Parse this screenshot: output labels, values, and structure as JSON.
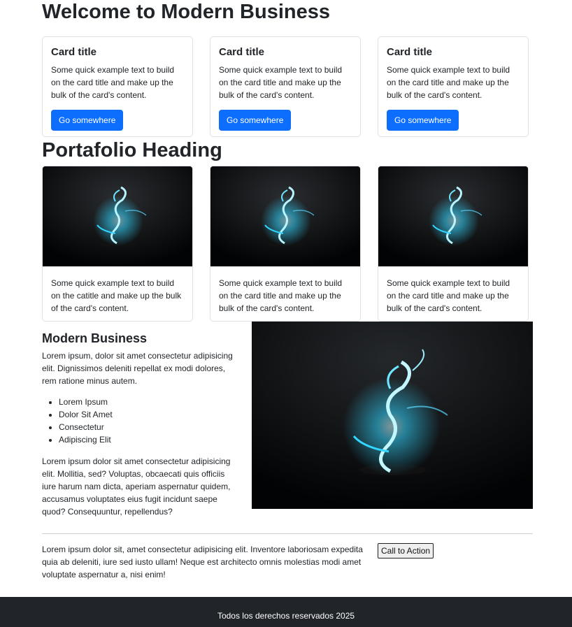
{
  "page": {
    "title": "Welcome to Modern Business"
  },
  "feature_cards": [
    {
      "title": "Card title",
      "text": "Some quick example text to build on the card title and make up the bulk of the card's content.",
      "button": "Go somewhere"
    },
    {
      "title": "Card title",
      "text": "Some quick example text to build on the card title and make up the bulk of the card's content.",
      "button": "Go somewhere"
    },
    {
      "title": "Card title",
      "text": "Some quick example text to build on the card title and make up the bulk of the card's content.",
      "button": "Go somewhere"
    }
  ],
  "portfolio": {
    "heading": "Portafolio Heading",
    "items": [
      {
        "text": "Some quick example text to build on the catitle and make up the bulk of the card's content."
      },
      {
        "text": "Some quick example text to build on the card title and make up the bulk of the card's content."
      },
      {
        "text": "Some quick example text to build on the card title and make up the bulk of the card's content."
      }
    ]
  },
  "about": {
    "title": "Modern Business",
    "intro": "Lorem ipsum, dolor sit amet consectetur adipisicing elit. Dignissimos deleniti repellat ex modi dolores, rem ratione minus autem.",
    "list": [
      "Lorem Ipsum",
      "Dolor Sit Amet",
      "Consectetur",
      "Adipiscing Elit"
    ],
    "outro": "Lorem ipsum dolor sit amet consectetur adipisicing elit. Mollitia, sed? Voluptas, obcaecati quis officiis iure harum nam dicta, aperiam aspernatur quidem, accusamus voluptates eius fugit incidunt saepe quod? Consequuntur, repellendus?"
  },
  "cta": {
    "text": "Lorem ipsum dolor sit, amet consectetur adipisicing elit. Inventore laboriosam expedita quia ab deleniti, iure sed iusto ullam! Neque est architecto omnis molestias modi amet voluptate aspernatur a, nisi enim!",
    "button": "Call to Action"
  },
  "footer": {
    "text": "Todos los derechos reservados 2025"
  },
  "colors": {
    "primary": "#0d6efd",
    "footer_bg": "#212529",
    "dragon_glow": "#33d6ff"
  },
  "icons": {
    "portfolio_image": "dragon-glow-image"
  }
}
